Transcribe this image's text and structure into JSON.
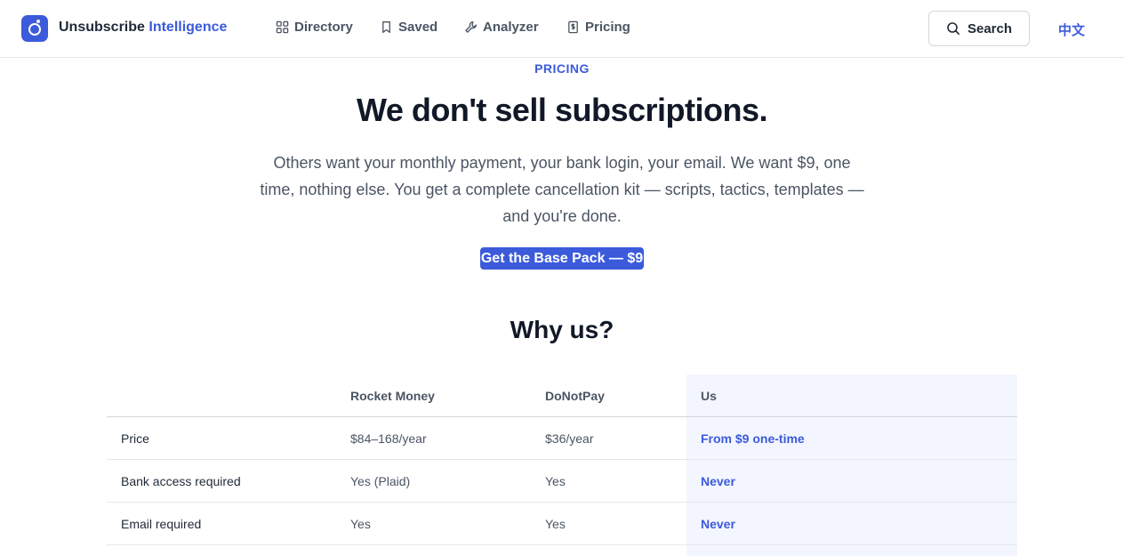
{
  "brand": {
    "name": "Unsubscribe",
    "accent": "Intelligence",
    "color": "#3b5bdb"
  },
  "nav": [
    {
      "label": "Directory",
      "icon": "grid-icon"
    },
    {
      "label": "Saved",
      "icon": "bookmark-icon"
    },
    {
      "label": "Analyzer",
      "icon": "wrench-icon"
    },
    {
      "label": "Pricing",
      "icon": "receipt-dollar-icon"
    }
  ],
  "header": {
    "search_label": "Search",
    "language_label": "中文"
  },
  "hero": {
    "eyebrow": "PRICING",
    "title": "We don't sell subscriptions.",
    "description": "Others want your monthly payment, your bank login, your email. We want $9, one time, nothing else. You get a complete cancellation kit — scripts, tactics, templates — and you're done.",
    "cta_label": "Get the Base Pack — $9"
  },
  "comparison": {
    "title": "Why us?",
    "columns": [
      "",
      "Rocket Money",
      "DoNotPay",
      "Us"
    ],
    "rows": [
      [
        "Price",
        "$84–168/year",
        "$36/year",
        "From $9 one-time"
      ],
      [
        "Bank access required",
        "Yes (Plaid)",
        "Yes",
        "Never"
      ],
      [
        "Email required",
        "Yes",
        "Yes",
        "Never"
      ]
    ]
  }
}
